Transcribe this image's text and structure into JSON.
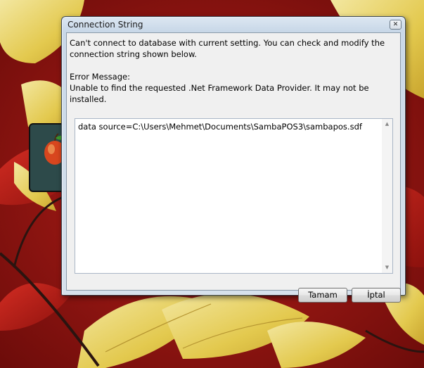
{
  "window": {
    "title": "Connection String",
    "close_glyph": "✕"
  },
  "message": {
    "intro": "Can't connect to database with current setting. You can check and modify the connection string shown below.",
    "error_label": "Error Message:",
    "error_text": "Unable to find the requested .Net Framework Data Provider.  It may not be installed."
  },
  "connection": {
    "value": "data source=C:\\Users\\Mehmet\\Documents\\SambaPOS3\\sambapos.sdf"
  },
  "scrollbar": {
    "up_glyph": "▲",
    "down_glyph": "▼"
  },
  "buttons": {
    "ok_label": "Tamam",
    "cancel_label": "İptal"
  },
  "desktop": {
    "icons": [
      "apple-icon"
    ],
    "colors": {
      "wallpaper_red": "#9a1410",
      "leaf_yellow": "#e8cf5c"
    }
  }
}
